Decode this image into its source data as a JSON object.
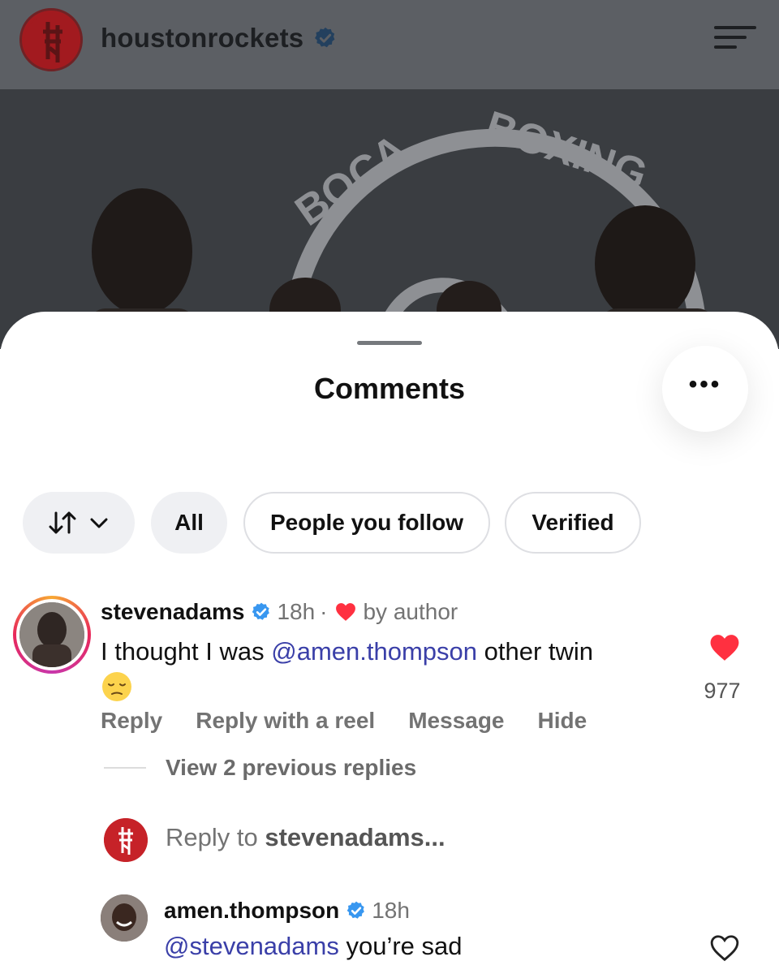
{
  "header": {
    "username": "houstonrockets"
  },
  "photo": {
    "sign_text": "BOCA BOXING"
  },
  "sheet": {
    "title": "Comments"
  },
  "filters": {
    "all": "All",
    "people_you_follow": "People you follow",
    "verified": "Verified"
  },
  "comment": {
    "username": "stevenadams",
    "time": "18h",
    "separator": "·",
    "liked_by": "by author",
    "text_before": "I thought I was ",
    "mention": "@amen.thompson",
    "text_after": " other twin",
    "likes": "977",
    "actions": {
      "reply": "Reply",
      "reply_reel": "Reply with a reel",
      "message": "Message",
      "hide": "Hide"
    },
    "view_replies": "View 2 previous replies"
  },
  "reply_box": {
    "prefix": "Reply to ",
    "target": "stevenadams..."
  },
  "reply": {
    "username": "amen.thompson",
    "time": "18h",
    "mention": "@stevenadams",
    "text": " you’re sad"
  },
  "colors": {
    "accent_blue": "#3897f0",
    "mention": "#3a3fa8",
    "like_red": "#ff3040",
    "rockets_red": "#c62228"
  },
  "icons": [
    "verified-badge-icon",
    "menu-icon",
    "more-icon",
    "sort-icon",
    "chevron-down-icon",
    "heart-icon",
    "heart-outline-icon",
    "pensive-emoji-icon"
  ]
}
